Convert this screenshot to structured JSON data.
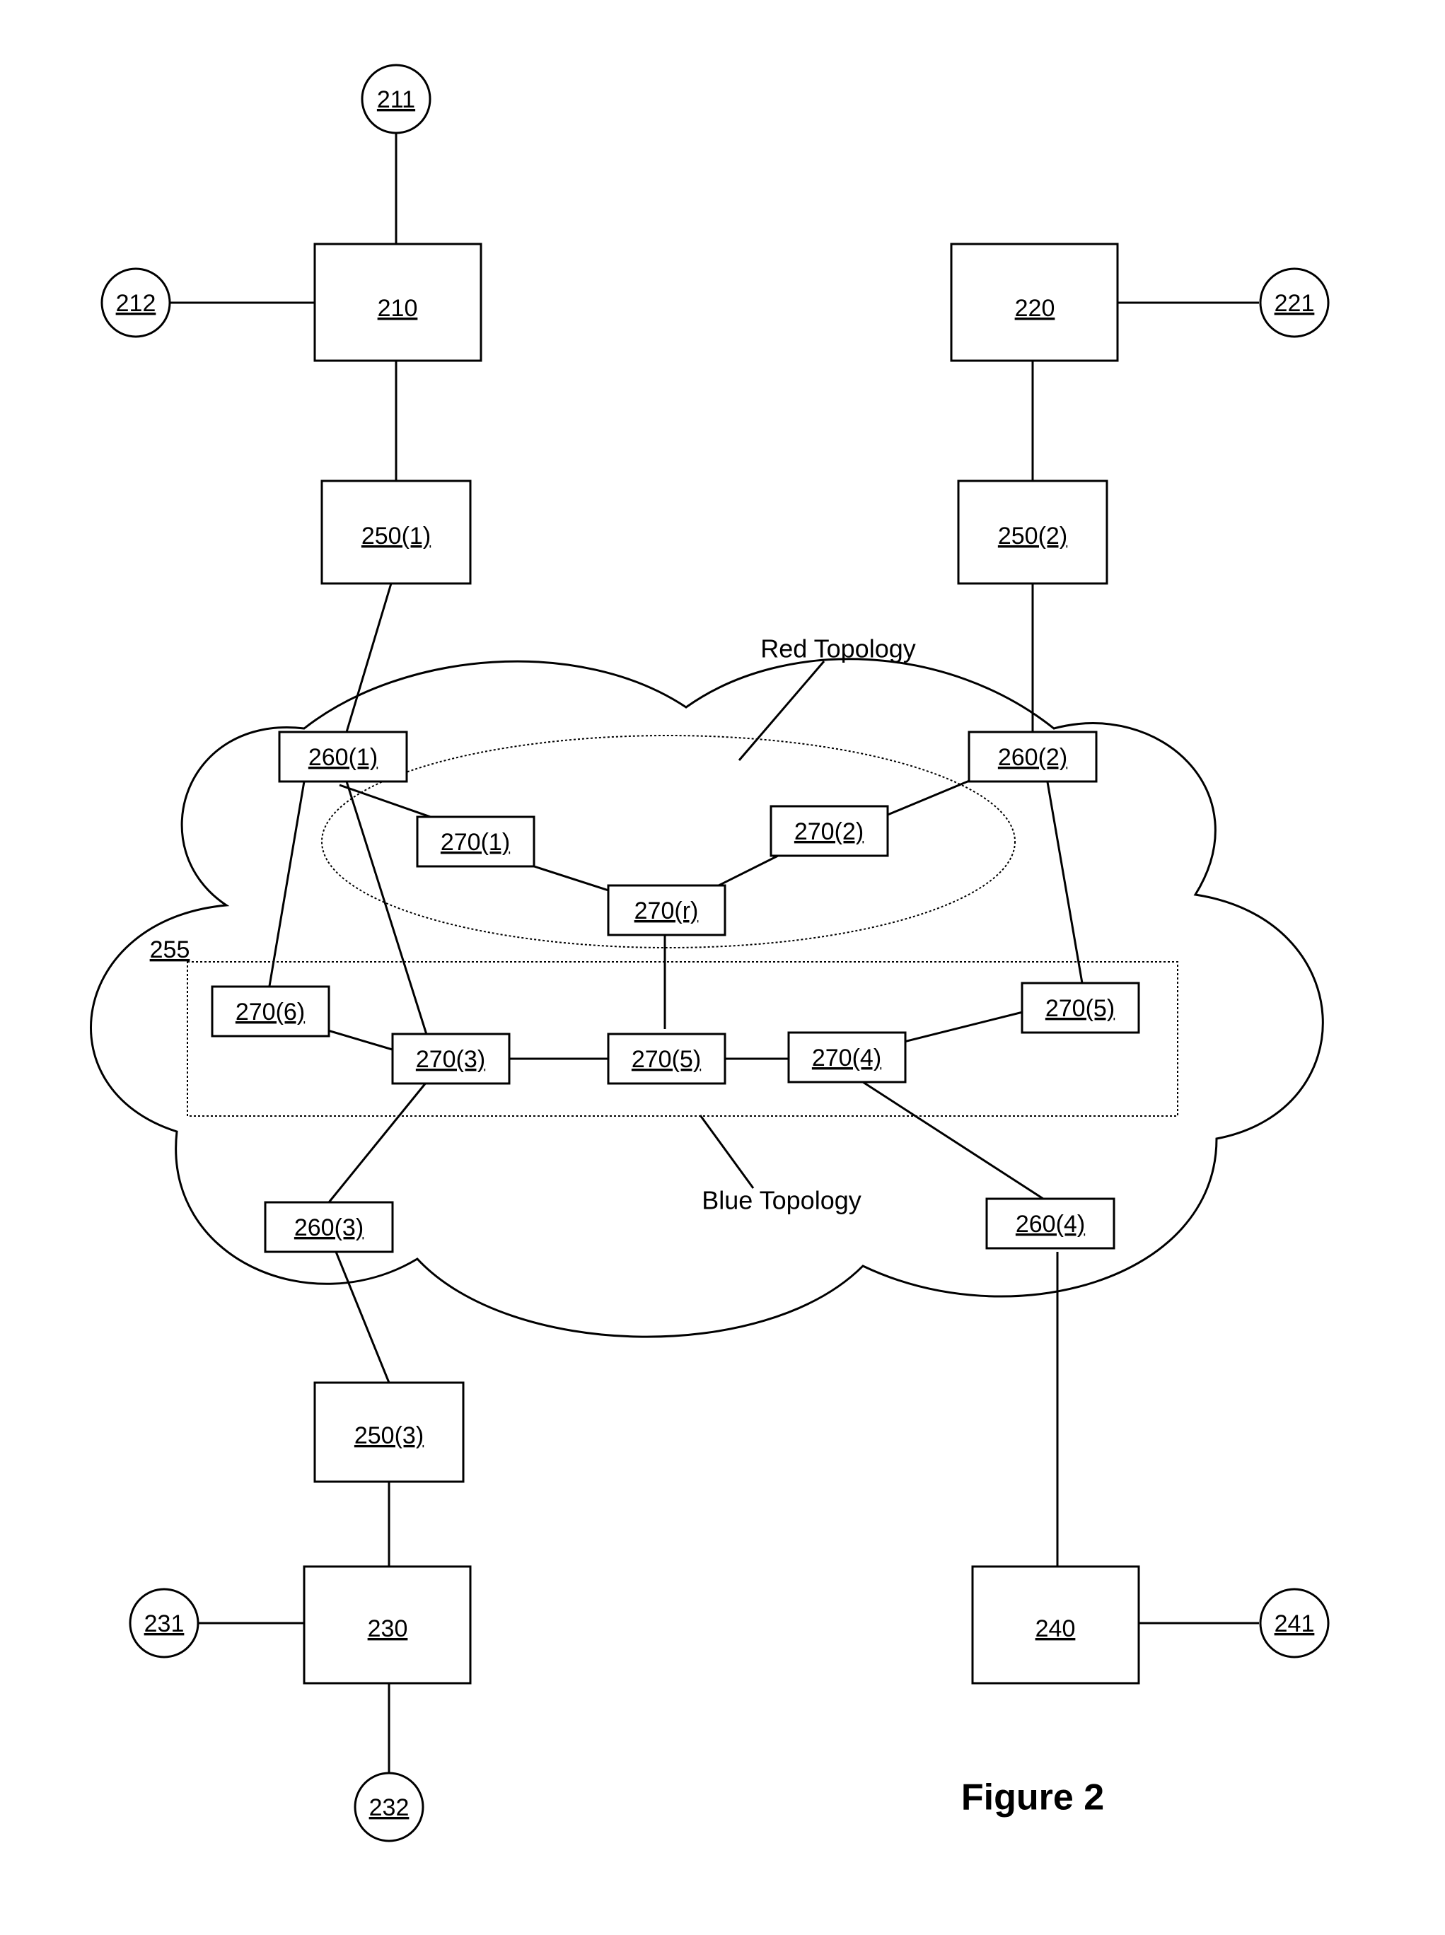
{
  "figure_caption": "Figure 2",
  "topologies": {
    "red_label": "Red Topology",
    "blue_label": "Blue Topology"
  },
  "nodes": {
    "n210": "210",
    "n211": "211",
    "n212": "212",
    "n220": "220",
    "n221": "221",
    "n230": "230",
    "n231": "231",
    "n232": "232",
    "n240": "240",
    "n241": "241",
    "n250_1": "250(1)",
    "n250_2": "250(2)",
    "n250_3": "250(3)",
    "n255": "255",
    "n260_1": "260(1)",
    "n260_2": "260(2)",
    "n260_3": "260(3)",
    "n260_4": "260(4)",
    "n270_1": "270(1)",
    "n270_2": "270(2)",
    "n270_3": "270(3)",
    "n270_4": "270(4)",
    "n270_5a": "270(5)",
    "n270_5b": "270(5)",
    "n270_6": "270(6)",
    "n270_r": "270(r)"
  }
}
